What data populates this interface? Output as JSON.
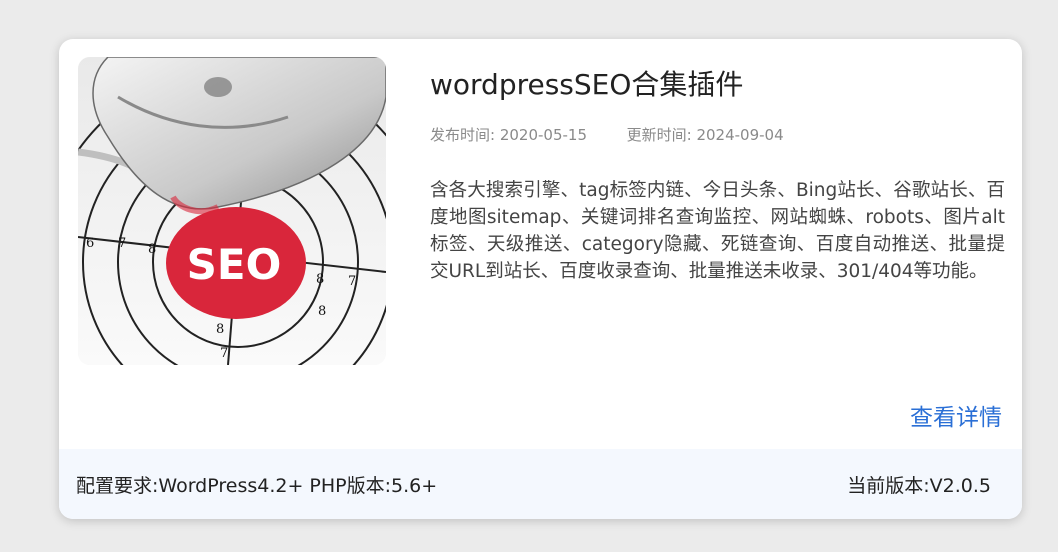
{
  "plugin": {
    "title": "wordpressSEO合集插件",
    "publish_label": "发布时间:",
    "publish_date": "2020-05-15",
    "update_label": "更新时间:",
    "update_date": "2024-09-04",
    "description": "含各大搜索引擎、tag标签内链、今日头条、Bing站长、谷歌站长、百度地图sitemap、关键词排名查询监控、网站蜘蛛、robots、图片alt标签、天级推送、category隐藏、死链查询、百度自动推送、批量提交URL到站长、百度收录查询、批量推送未收录、301/404等功能。",
    "details_link": "查看详情",
    "image_text": "SEO"
  },
  "footer": {
    "requirements": "配置要求:WordPress4.2+ PHP版本:5.6+",
    "version": "当前版本:V2.0.5"
  },
  "colors": {
    "accent": "#2a6fd6",
    "seo_badge": "#d9263b"
  }
}
